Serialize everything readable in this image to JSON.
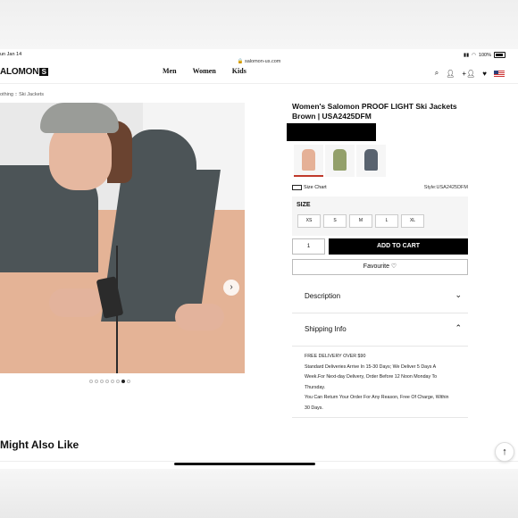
{
  "status_bar": {
    "time": "un Jan 14",
    "url": "salomon-us.com",
    "battery": "100%"
  },
  "header": {
    "brand": "ALOMON",
    "brand_mark": "S",
    "nav": [
      "Men",
      "Women",
      "Kids"
    ],
    "icons": [
      "search-icon",
      "user-icon",
      "add-user-icon",
      "heart-icon",
      "us-flag-icon"
    ]
  },
  "breadcrumb": {
    "items": [
      "othing",
      "Ski Jackets"
    ],
    "separator": "::"
  },
  "gallery": {
    "dot_count": 8,
    "active_dot": 6
  },
  "product": {
    "title": "Women's Salomon PROOF LIGHT Ski Jackets Brown | USA2425DFM",
    "size_chart_label": "Size Chart",
    "style_label": "Style:USA2425DFM",
    "size_heading": "SIZE",
    "sizes": [
      "XS",
      "S",
      "M",
      "L",
      "XL"
    ],
    "quantity": "1",
    "add_to_cart": "ADD TO CART",
    "favourite": "Favourite ♡",
    "swatch_colors": [
      "#e5b197",
      "#93a06b",
      "#59636f"
    ]
  },
  "accordion": [
    {
      "label": "Description",
      "expanded": false
    },
    {
      "label": "Shipping Info",
      "expanded": true
    }
  ],
  "shipping_text": [
    "FREE DELIVERY OVER $90",
    "Standard Deliveries Arrive In 15-30 Days; We Deliver 5 Days A",
    "Week.For Next-day Delivery, Order Before 12 Noon Monday To",
    "Thursday.",
    "You Can Return Your Order For Any Reason, Free Of Charge, Within",
    "30 Days."
  ],
  "section": {
    "may_like": "Might Also Like"
  }
}
